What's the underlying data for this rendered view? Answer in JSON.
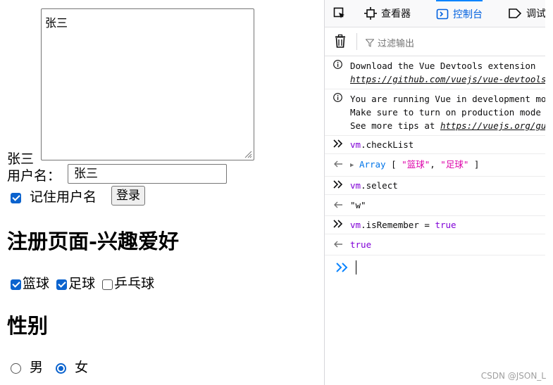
{
  "form": {
    "display_name": "张三",
    "textarea_value": "张三",
    "username_label": "用户名：",
    "username_value": "张三",
    "remember_label": "记住用户名",
    "remember_checked": true,
    "login_button": "登录",
    "hobby_heading": "注册页面-兴趣爱好",
    "hobbies": [
      {
        "label": "篮球",
        "checked": true
      },
      {
        "label": "足球",
        "checked": true
      },
      {
        "label": "乒乓球",
        "checked": false
      }
    ],
    "gender_heading": "性别",
    "genders": [
      {
        "label": "男",
        "selected": false
      },
      {
        "label": "女",
        "selected": true
      }
    ]
  },
  "devtools": {
    "tabs": [
      {
        "label": "查看器",
        "icon": "inspector-icon"
      },
      {
        "label": "控制台",
        "icon": "console-icon",
        "active": true
      },
      {
        "label": "调试",
        "icon": "debugger-icon"
      }
    ],
    "filter_placeholder": "过滤输出",
    "messages": {
      "info1_line1": "Download the Vue Devtools extension",
      "info1_link": "https://github.com/vuejs/vue-devtools",
      "info2_line1": "You are running Vue in development mode.",
      "info2_line2": "Make sure to turn on production mode",
      "info2_line3_prefix": "See more tips at ",
      "info2_link": "https://vuejs.org/guide/deployment.html",
      "cmd1_obj": "vm",
      "cmd1_prop": ".checkList",
      "res1_type": "Array",
      "res1_open": " [ ",
      "res1_item1": "\"篮球\"",
      "res1_sep": ", ",
      "res1_item2": "\"足球\"",
      "res1_close": " ]",
      "cmd2_obj": "vm",
      "cmd2_prop": ".select",
      "res2_value": "\"w\"",
      "cmd3_obj": "vm",
      "cmd3_prop": ".isRemember",
      "cmd3_op": " = ",
      "cmd3_val": "true",
      "res3_value": "true"
    }
  },
  "watermark": "CSDN @JSON_L",
  "colors": {
    "accent": "#0b63ce",
    "devtools_active": "#0060df"
  }
}
